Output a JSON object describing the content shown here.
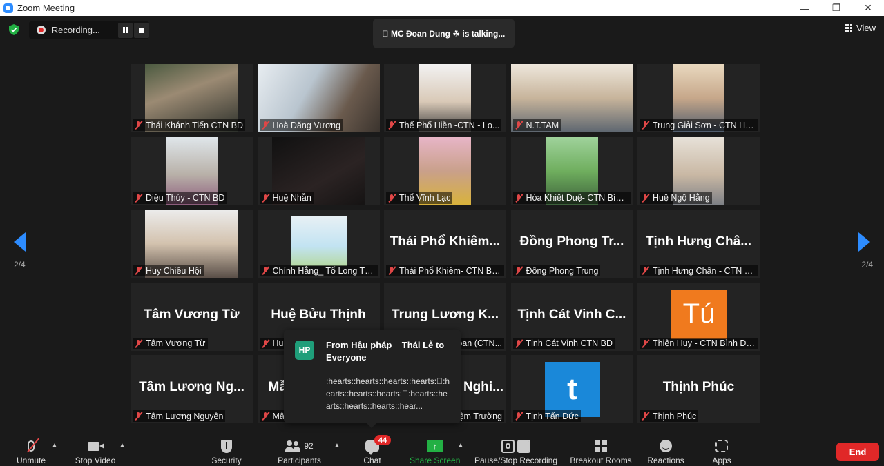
{
  "window": {
    "title": "Zoom Meeting",
    "minimize": "—",
    "restore": "❐",
    "close": "✕"
  },
  "topbar": {
    "recording_label": "Recording...",
    "talking": "\u0000 MC Đoan Dung ☘ is talking...",
    "view_label": "View"
  },
  "pagination": {
    "left": "2/4",
    "right": "2/4"
  },
  "tiles": [
    {
      "label": "Thái Khánh Tiến CTN BD",
      "big_name": ""
    },
    {
      "label": "Hoà Đăng Vương",
      "big_name": ""
    },
    {
      "label": "Thể Phổ Hiền  -CTN - Lo...",
      "big_name": ""
    },
    {
      "label": "N.T.TAM",
      "big_name": ""
    },
    {
      "label": "Trung Giải Sơn - CTN Hà...",
      "big_name": ""
    },
    {
      "label": "Diệu Thúy - CTN BD",
      "big_name": ""
    },
    {
      "label": "Huệ Nhẫn",
      "big_name": ""
    },
    {
      "label": "Thể Vĩnh Lạc",
      "big_name": ""
    },
    {
      "label": "Hòa Khiết Duệ- CTN Bình...",
      "big_name": ""
    },
    {
      "label": "Huệ Ngộ Hằng",
      "big_name": ""
    },
    {
      "label": "Huy Chiếu Hội",
      "big_name": ""
    },
    {
      "label": "Chính Hằng_ Tổ Long Th...",
      "big_name": ""
    },
    {
      "label": "Thái Phổ Khiêm- CTN Bìn...",
      "big_name": "Thái Phổ Khiêm..."
    },
    {
      "label": "Đồng Phong Trung",
      "big_name": "Đồng Phong Tr..."
    },
    {
      "label": "Tịnh Hưng Chân - CTN Bì...",
      "big_name": "Tịnh Hưng Châ..."
    },
    {
      "label": "Tâm Vương Từ",
      "big_name": "Tâm Vương Từ"
    },
    {
      "label": "Huệ",
      "big_name": "Huệ Bửu Thịnh"
    },
    {
      "label": "oan (CTN...",
      "big_name": "Trung Lương K..."
    },
    {
      "label": "Tịnh Cát Vinh CTN BD",
      "big_name": "Tịnh Cát Vinh C..."
    },
    {
      "label": "Thiện Huy - CTN Bình Dư...",
      "big_name": "",
      "avatar": "Tú"
    },
    {
      "label": "Tâm Lương Nguyên",
      "big_name": "Tâm Lương Ng..."
    },
    {
      "label": "Mẫ",
      "big_name": "Mẫ"
    },
    {
      "label": "ệm Trường",
      "big_name": "Nghi..."
    },
    {
      "label": "Tịnh Tấn Đức",
      "big_name": "",
      "avatar": "t"
    },
    {
      "label": "Thịnh Phúc",
      "big_name": "Thịnh Phúc"
    }
  ],
  "chat_toast": {
    "avatar": "HP",
    "from": "From Hậu pháp _ Thái Lễ to Everyone",
    "message": ":hearts::hearts::hearts::hearts:\u0000:hearts::hearts::hearts:\u0000:hearts::hearts::hearts::hearts::hear..."
  },
  "toolbar": {
    "unmute": "Unmute",
    "stop_video": "Stop Video",
    "security": "Security",
    "participants": "Participants",
    "participants_count": "92",
    "chat": "Chat",
    "chat_badge": "44",
    "share_screen": "Share Screen",
    "pause_stop_recording": "Pause/Stop Recording",
    "breakout_rooms": "Breakout Rooms",
    "reactions": "Reactions",
    "apps": "Apps",
    "end": "End"
  },
  "colors": {
    "accent": "#2d8cff",
    "end": "#e02828",
    "share": "#23b044",
    "muted": "#e04747"
  }
}
